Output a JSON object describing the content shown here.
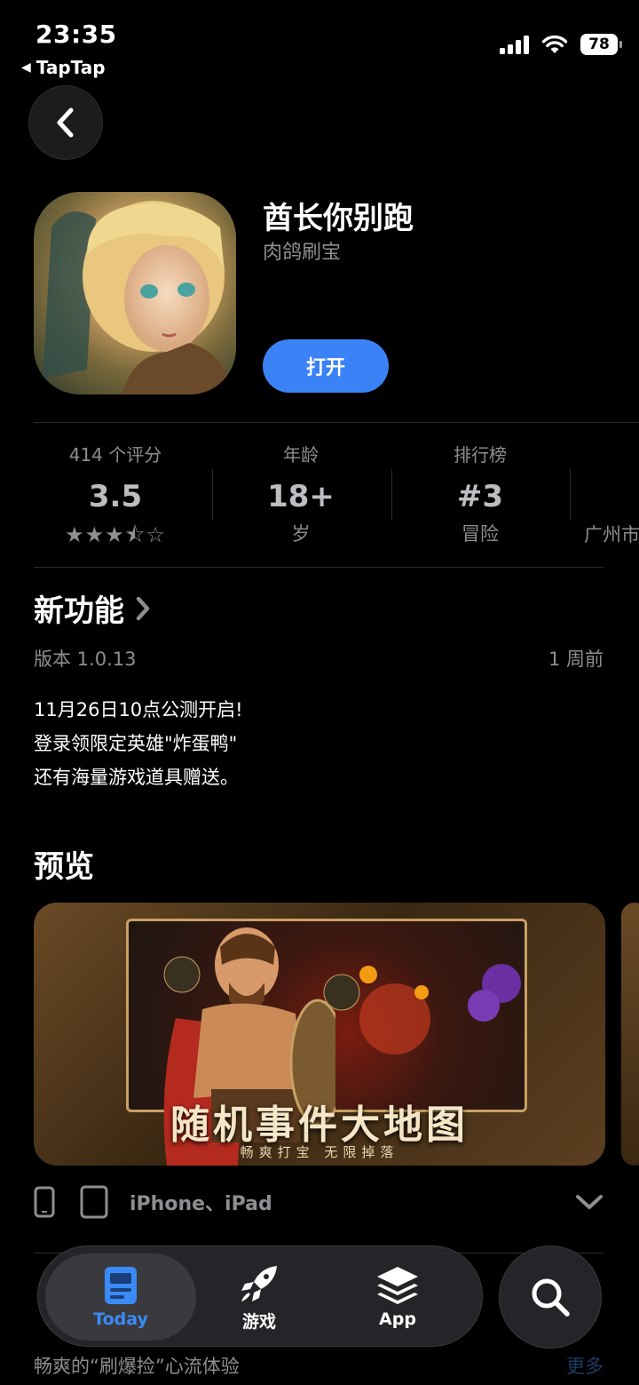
{
  "status": {
    "time": "23:35",
    "back_app": "TapTap",
    "battery": "78"
  },
  "app": {
    "title": "酋长你别跑",
    "developer": "肉鸽刷宝",
    "open_label": "打开"
  },
  "info": {
    "ratings_label": "414 个评分",
    "rating_value": "3.5",
    "rating_stars": "★★★⯪☆",
    "age_label": "年龄",
    "age_value": "18+",
    "age_sub": "岁",
    "chart_label": "排行榜",
    "chart_value": "#3",
    "chart_sub": "冒险",
    "dev_sub": "广州市"
  },
  "whats_new": {
    "title": "新功能",
    "version": "版本 1.0.13",
    "date": "1 周前",
    "notes": [
      "11月26日10点公测开启!",
      "登录领限定英雄\"炸蛋鸭\"",
      "还有海量游戏道具赠送。"
    ]
  },
  "preview": {
    "title": "预览",
    "image_title": "随机事件大地图",
    "image_subtitle": "畅爽打宝 无限掉落",
    "devices": "iPhone、iPad"
  },
  "description": {
    "line": "畅爽的“刷爆捡”心流体验",
    "more": "更多"
  },
  "tabs": [
    {
      "label": "Today",
      "active": true
    },
    {
      "label": "游戏",
      "active": false
    },
    {
      "label": "App",
      "active": false
    }
  ]
}
